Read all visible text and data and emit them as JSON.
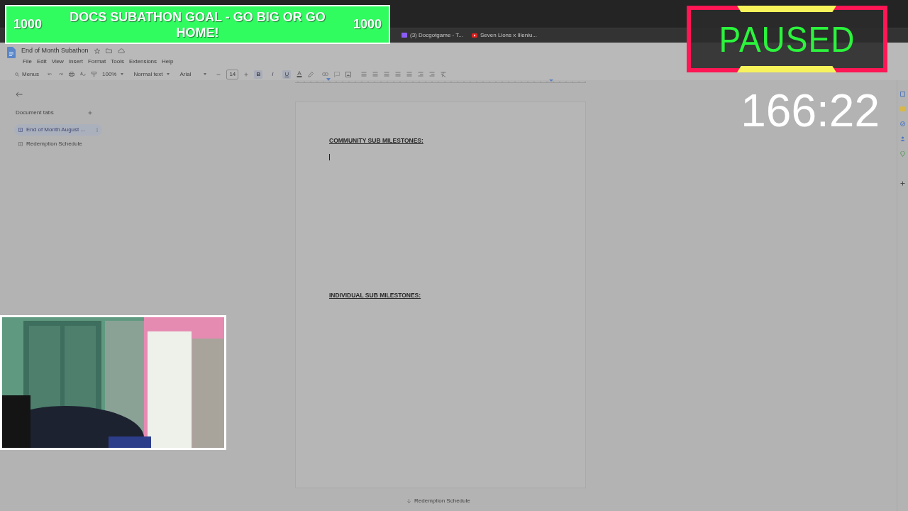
{
  "banner": {
    "left_count": "1000",
    "title": "DOCS SUBATHON GOAL - GO BIG OR GO HOME!",
    "right_count": "1000"
  },
  "browser": {
    "bookmarks": [
      {
        "label": "(3) Docgotgame - T...",
        "kind": "twitch"
      },
      {
        "label": "Seven Lions x Illeniu...",
        "kind": "youtube"
      }
    ]
  },
  "document": {
    "title": "End of Month Subathon",
    "menus": [
      "File",
      "Edit",
      "View",
      "Insert",
      "Format",
      "Tools",
      "Extensions",
      "Help"
    ],
    "toolbar": {
      "search": "Menus",
      "zoom": "100%",
      "style": "Normal text",
      "font": "Arial",
      "size": "14",
      "format_buttons": [
        {
          "label": "B",
          "active": true
        },
        {
          "label": "I",
          "active": false
        },
        {
          "label": "U",
          "active": true
        }
      ]
    },
    "sidebar": {
      "heading": "Document tabs",
      "tabs": [
        {
          "label": "End of Month August ...",
          "selected": true
        },
        {
          "label": "Redemption Schedule",
          "selected": false
        }
      ]
    },
    "headings": [
      "COMMUNITY SUB MILESTONES:",
      "INDIVIDUAL SUB MILESTONES:"
    ],
    "next_tab": "Redemption Schedule"
  },
  "paused": {
    "label": "PAUSED"
  },
  "timer": "166:22"
}
